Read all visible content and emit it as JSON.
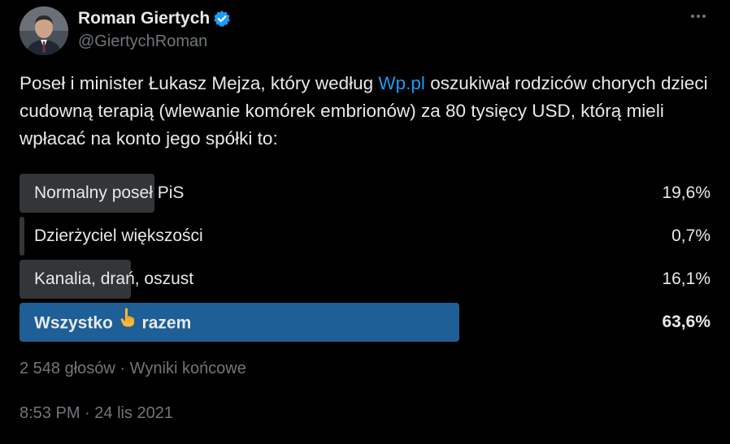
{
  "author": {
    "display_name": "Roman Giertych",
    "handle": "@GiertychRoman",
    "verified": true
  },
  "tweet": {
    "text_before_link": "Poseł i minister Łukasz Mejza, który według ",
    "link_text": "Wp.pl",
    "text_after_link": " oszukiwał rodziców chorych dzieci cudowną terapią (wlewanie komórek embrionów) za 80 tysięcy USD, którą mieli wpłacać na konto jego spółki to:"
  },
  "poll": {
    "options": [
      {
        "label": "Normalny poseł PiS",
        "percent_text": "19,6%",
        "percent": 19.6,
        "winner": false
      },
      {
        "label": "Dzierżyciel większości",
        "percent_text": "0,7%",
        "percent": 0.7,
        "winner": false
      },
      {
        "label": "Kanalia, drań, oszust",
        "percent_text": "16,1%",
        "percent": 16.1,
        "winner": false
      },
      {
        "label_before_emoji": "Wszystko",
        "label_after_emoji": "razem",
        "emoji": "pointing-up-hand-icon",
        "percent_text": "63,6%",
        "percent": 63.6,
        "winner": true
      }
    ],
    "votes": "2 548 głosów",
    "separator": "·",
    "status": "Wyniki końcowe"
  },
  "timestamp": {
    "time": "8:53 PM",
    "separator": "·",
    "date": "24 lis 2021"
  },
  "colors": {
    "background": "#000000",
    "text": "#e7e9ea",
    "muted": "#71767b",
    "link": "#1d9bf0",
    "poll_bar": "#333639",
    "poll_bar_winner": "#1d5f96",
    "verified": "#1d9bf0"
  }
}
